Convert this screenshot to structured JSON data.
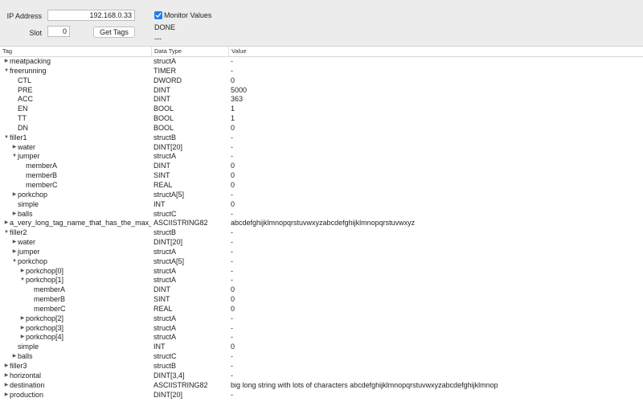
{
  "toolbar": {
    "ip_label": "IP Address",
    "ip_value": "192.168.0.33",
    "slot_label": "Slot",
    "slot_value": "0",
    "get_tags_label": "Get Tags",
    "monitor_label": "Monitor Values",
    "monitor_checked": true,
    "status_text": "DONE",
    "status_sub": "---"
  },
  "table": {
    "columns": [
      "Tag",
      "Data Type",
      "Value"
    ],
    "rows": [
      {
        "tag": "meatpacking",
        "type": "structA",
        "value": "-",
        "depth": 0,
        "toggle": "collapsed"
      },
      {
        "tag": "freerunning",
        "type": "TIMER",
        "value": "-",
        "depth": 0,
        "toggle": "expanded"
      },
      {
        "tag": "CTL",
        "type": "DWORD",
        "value": "0",
        "depth": 1,
        "toggle": "none"
      },
      {
        "tag": "PRE",
        "type": "DINT",
        "value": "5000",
        "depth": 1,
        "toggle": "none"
      },
      {
        "tag": "ACC",
        "type": "DINT",
        "value": "363",
        "depth": 1,
        "toggle": "none"
      },
      {
        "tag": "EN",
        "type": "BOOL",
        "value": "1",
        "depth": 1,
        "toggle": "none"
      },
      {
        "tag": "TT",
        "type": "BOOL",
        "value": "1",
        "depth": 1,
        "toggle": "none"
      },
      {
        "tag": "DN",
        "type": "BOOL",
        "value": "0",
        "depth": 1,
        "toggle": "none"
      },
      {
        "tag": "filler1",
        "type": "structB",
        "value": "-",
        "depth": 0,
        "toggle": "expanded"
      },
      {
        "tag": "water",
        "type": "DINT[20]",
        "value": "-",
        "depth": 1,
        "toggle": "collapsed"
      },
      {
        "tag": "jumper",
        "type": "structA",
        "value": "-",
        "depth": 1,
        "toggle": "expanded"
      },
      {
        "tag": "memberA",
        "type": "DINT",
        "value": "0",
        "depth": 2,
        "toggle": "none"
      },
      {
        "tag": "memberB",
        "type": "SINT",
        "value": "0",
        "depth": 2,
        "toggle": "none"
      },
      {
        "tag": "memberC",
        "type": "REAL",
        "value": "0",
        "depth": 2,
        "toggle": "none"
      },
      {
        "tag": "porkchop",
        "type": "structA[5]",
        "value": "-",
        "depth": 1,
        "toggle": "collapsed"
      },
      {
        "tag": "simple",
        "type": "INT",
        "value": "0",
        "depth": 1,
        "toggle": "none"
      },
      {
        "tag": "balls",
        "type": "structC",
        "value": "-",
        "depth": 1,
        "toggle": "collapsed"
      },
      {
        "tag": "a_very_long_tag_name_that_has_the_max_nu",
        "type": "ASCIISTRING82",
        "value": "abcdefghijklmnopqrstuvwxyzabcdefghijklmnopqrstuvwxyz",
        "depth": 0,
        "toggle": "collapsed"
      },
      {
        "tag": "filler2",
        "type": "structB",
        "value": "-",
        "depth": 0,
        "toggle": "expanded"
      },
      {
        "tag": "water",
        "type": "DINT[20]",
        "value": "-",
        "depth": 1,
        "toggle": "collapsed"
      },
      {
        "tag": "jumper",
        "type": "structA",
        "value": "-",
        "depth": 1,
        "toggle": "collapsed"
      },
      {
        "tag": "porkchop",
        "type": "structA[5]",
        "value": "-",
        "depth": 1,
        "toggle": "expanded"
      },
      {
        "tag": "porkchop[0]",
        "type": "structA",
        "value": "-",
        "depth": 2,
        "toggle": "collapsed"
      },
      {
        "tag": "porkchop[1]",
        "type": "structA",
        "value": "-",
        "depth": 2,
        "toggle": "expanded"
      },
      {
        "tag": "memberA",
        "type": "DINT",
        "value": "0",
        "depth": 3,
        "toggle": "none"
      },
      {
        "tag": "memberB",
        "type": "SINT",
        "value": "0",
        "depth": 3,
        "toggle": "none"
      },
      {
        "tag": "memberC",
        "type": "REAL",
        "value": "0",
        "depth": 3,
        "toggle": "none"
      },
      {
        "tag": "porkchop[2]",
        "type": "structA",
        "value": "-",
        "depth": 2,
        "toggle": "collapsed"
      },
      {
        "tag": "porkchop[3]",
        "type": "structA",
        "value": "-",
        "depth": 2,
        "toggle": "collapsed"
      },
      {
        "tag": "porkchop[4]",
        "type": "structA",
        "value": "-",
        "depth": 2,
        "toggle": "collapsed"
      },
      {
        "tag": "simple",
        "type": "INT",
        "value": "0",
        "depth": 1,
        "toggle": "none"
      },
      {
        "tag": "balls",
        "type": "structC",
        "value": "-",
        "depth": 1,
        "toggle": "collapsed"
      },
      {
        "tag": "filler3",
        "type": "structB",
        "value": "-",
        "depth": 0,
        "toggle": "collapsed"
      },
      {
        "tag": "horizontal",
        "type": "DINT[3,4]",
        "value": "-",
        "depth": 0,
        "toggle": "collapsed"
      },
      {
        "tag": "destination",
        "type": "ASCIISTRING82",
        "value": "big long string with lots of characters abcdefghijklmnopqrstuvwxyzabcdefghijklmnop",
        "depth": 0,
        "toggle": "collapsed"
      },
      {
        "tag": "production",
        "type": "DINT[20]",
        "value": "-",
        "depth": 0,
        "toggle": "collapsed"
      }
    ]
  },
  "icons": {
    "collapsed": "disclosure-triangle-right-icon",
    "expanded": "disclosure-triangle-down-icon",
    "checkbox": "checkmark-icon"
  },
  "colors": {
    "toolbar_bg": "#ececec",
    "checkbox_accent": "#1f7cf6"
  }
}
